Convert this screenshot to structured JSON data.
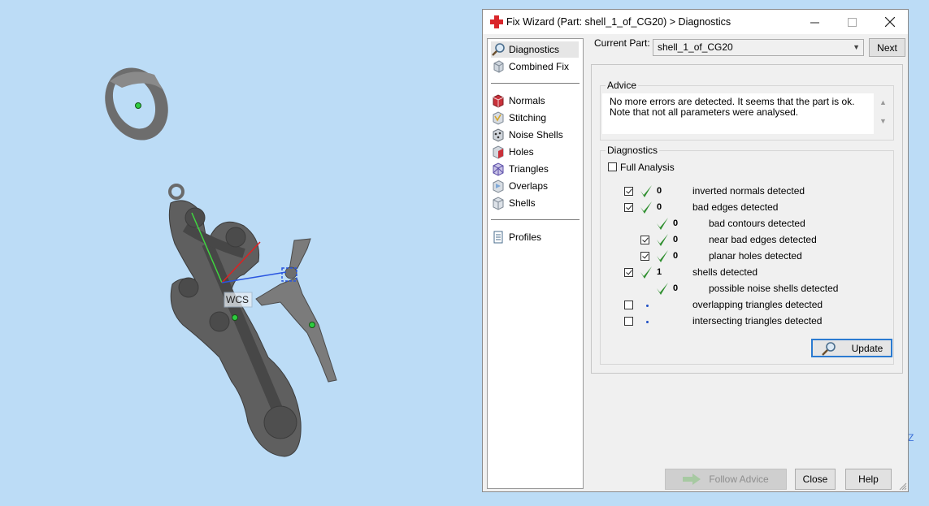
{
  "viewport": {
    "label": "WCS",
    "axis_letter": "Z"
  },
  "dialog": {
    "title": "Fix Wizard (Part: shell_1_of_CG20) > Diagnostics",
    "current_part_label": "Current Part:",
    "current_part_value": "shell_1_of_CG20",
    "next_label": "Next",
    "nav": [
      {
        "label": "Diagnostics",
        "icon": "magnifier-icon",
        "selected": true
      },
      {
        "label": "Combined Fix",
        "icon": "cube-icon"
      },
      {
        "label": "Normals",
        "icon": "normals-icon"
      },
      {
        "label": "Stitching",
        "icon": "stitching-icon"
      },
      {
        "label": "Noise Shells",
        "icon": "noise-shells-icon"
      },
      {
        "label": "Holes",
        "icon": "holes-icon"
      },
      {
        "label": "Triangles",
        "icon": "triangles-icon"
      },
      {
        "label": "Overlaps",
        "icon": "overlaps-icon"
      },
      {
        "label": "Shells",
        "icon": "shells-icon"
      },
      {
        "label": "Profiles",
        "icon": "document-icon"
      }
    ],
    "advice": {
      "label": "Advice",
      "text": "No more errors are detected. It seems that the part is ok. Note that not all parameters were analysed."
    },
    "diagnostics": {
      "label": "Diagnostics",
      "full_analysis_label": "Full Analysis",
      "rows": [
        {
          "checkbox": true,
          "checked": true,
          "status": "ok",
          "count": "0",
          "label": "inverted normals detected",
          "indent": 0
        },
        {
          "checkbox": true,
          "checked": true,
          "status": "ok",
          "count": "0",
          "label": "bad edges detected",
          "indent": 0
        },
        {
          "checkbox": false,
          "checked": false,
          "status": "ok",
          "count": "0",
          "label": "bad contours detected",
          "indent": 1
        },
        {
          "checkbox": true,
          "checked": true,
          "status": "ok",
          "count": "0",
          "label": "near bad edges detected",
          "indent": 1
        },
        {
          "checkbox": true,
          "checked": true,
          "status": "ok",
          "count": "0",
          "label": "planar holes detected",
          "indent": 1
        },
        {
          "checkbox": true,
          "checked": true,
          "status": "ok",
          "count": "1",
          "label": "shells detected",
          "indent": 0
        },
        {
          "checkbox": false,
          "checked": false,
          "status": "ok",
          "count": "0",
          "label": "possible noise shells detected",
          "indent": 1
        },
        {
          "checkbox": true,
          "checked": false,
          "status": "none",
          "count": "",
          "label": "overlapping triangles detected",
          "indent": 0
        },
        {
          "checkbox": true,
          "checked": false,
          "status": "none",
          "count": "",
          "label": "intersecting triangles detected",
          "indent": 0
        }
      ],
      "update_label": "Update"
    },
    "buttons": {
      "follow_advice": "Follow Advice",
      "close": "Close",
      "help": "Help"
    }
  },
  "colors": {
    "background": "#bcdcf6",
    "ok_check": "#2f8f2f",
    "accent": "#2b7bd1"
  }
}
